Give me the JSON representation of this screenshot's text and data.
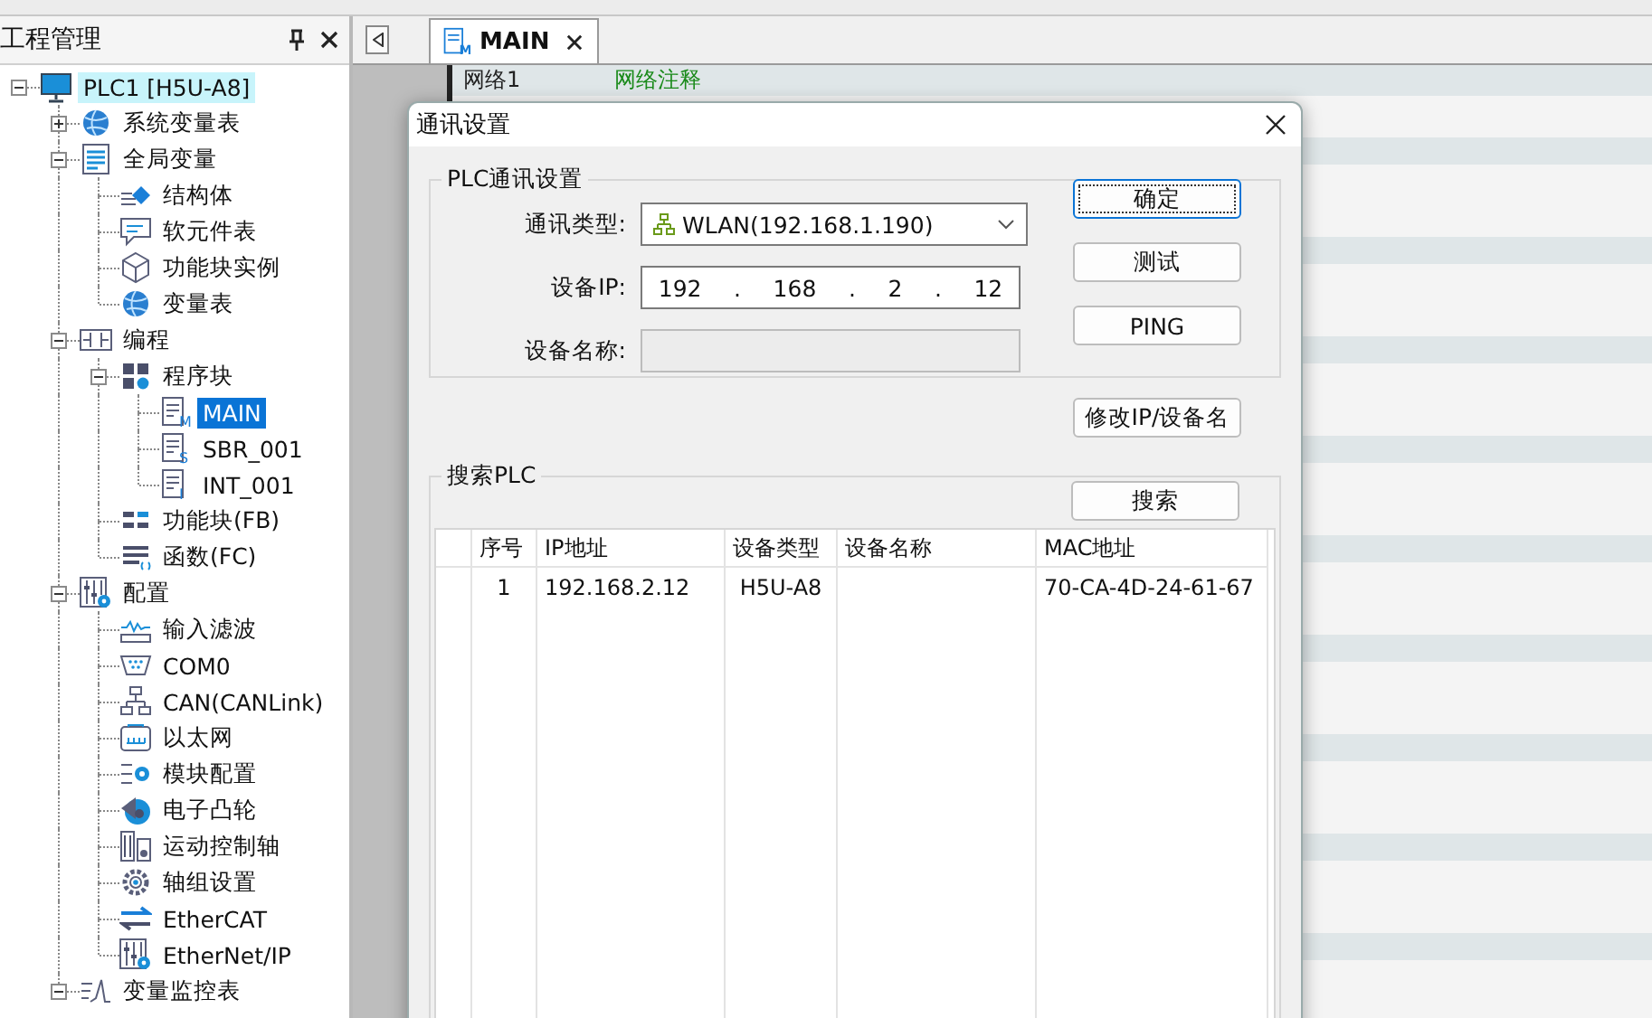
{
  "project_panel": {
    "title": "工程管理",
    "tree": [
      {
        "label": "PLC1 [H5U-A8]",
        "kind": "monitor",
        "selected": false,
        "expanded": true,
        "children": [
          {
            "label": "系统变量表",
            "kind": "globe",
            "selected": false,
            "expanded": false
          },
          {
            "label": "全局变量",
            "kind": "document",
            "selected": false,
            "expanded": true,
            "children": [
              {
                "label": "结构体",
                "kind": "struct",
                "selected": false
              },
              {
                "label": "软元件表",
                "kind": "comment",
                "selected": false
              },
              {
                "label": "功能块实例",
                "kind": "cube",
                "selected": false
              },
              {
                "label": "变量表",
                "kind": "globe",
                "selected": false
              }
            ]
          },
          {
            "label": "编程",
            "kind": "ladder",
            "selected": false,
            "expanded": true,
            "children": [
              {
                "label": "程序块",
                "kind": "blocks",
                "selected": false,
                "expanded": true,
                "children": [
                  {
                    "label": "MAIN",
                    "kind": "program",
                    "letter": "M",
                    "selected": true
                  },
                  {
                    "label": "SBR_001",
                    "kind": "program",
                    "letter": "S",
                    "selected": false
                  },
                  {
                    "label": "INT_001",
                    "kind": "program",
                    "letter": "I",
                    "selected": false
                  }
                ]
              },
              {
                "label": "功能块(FB)",
                "kind": "fb",
                "selected": false
              },
              {
                "label": "函数(FC)",
                "kind": "fc",
                "selected": false
              }
            ]
          },
          {
            "label": "配置",
            "kind": "config",
            "selected": false,
            "expanded": true,
            "children": [
              {
                "label": "输入滤波",
                "kind": "filter",
                "selected": false
              },
              {
                "label": "COM0",
                "kind": "serial",
                "selected": false
              },
              {
                "label": "CAN(CANLink)",
                "kind": "network",
                "selected": false
              },
              {
                "label": "以太网",
                "kind": "ethernet",
                "selected": false
              },
              {
                "label": "模块配置",
                "kind": "module",
                "selected": false
              },
              {
                "label": "电子凸轮",
                "kind": "cam",
                "selected": false
              },
              {
                "label": "运动控制轴",
                "kind": "axis",
                "selected": false
              },
              {
                "label": "轴组设置",
                "kind": "gear",
                "selected": false
              },
              {
                "label": "EtherCAT",
                "kind": "arrows",
                "selected": false
              },
              {
                "label": "EtherNet/IP",
                "kind": "config",
                "selected": false
              }
            ]
          },
          {
            "label": "变量监控表",
            "kind": "chart",
            "selected": false,
            "expanded": true
          }
        ]
      }
    ]
  },
  "editor": {
    "tabs": [
      {
        "label": "MAIN",
        "letter": "M",
        "selected": true
      }
    ],
    "network": {
      "label": "网络1",
      "comment": "网络注释"
    }
  },
  "dialog": {
    "title": "通讯设置",
    "plc_settings": {
      "legend": "PLC通讯设置",
      "comm_type": {
        "label": "通讯类型:",
        "value": "WLAN(192.168.1.190)"
      },
      "device_ip": {
        "label": "设备IP:",
        "octets": [
          "192",
          "168",
          "2",
          "12"
        ],
        "separator": "."
      },
      "device_name": {
        "label": "设备名称:",
        "disabled": true
      }
    },
    "buttons": [
      {
        "label": "确定",
        "default": true
      },
      {
        "label": "测试",
        "default": false
      },
      {
        "label": "PING",
        "default": false
      }
    ],
    "modify_button": "修改IP/设备名",
    "search": {
      "legend": "搜索PLC",
      "button": "搜索",
      "columns": [
        "序号",
        "IP地址",
        "设备类型",
        "设备名称",
        "MAC地址"
      ],
      "rows": [
        {
          "index": "1",
          "ip": "192.168.2.12",
          "type": "H5U-A8",
          "mac": "70-CA-4D-24-61-67"
        }
      ]
    }
  }
}
